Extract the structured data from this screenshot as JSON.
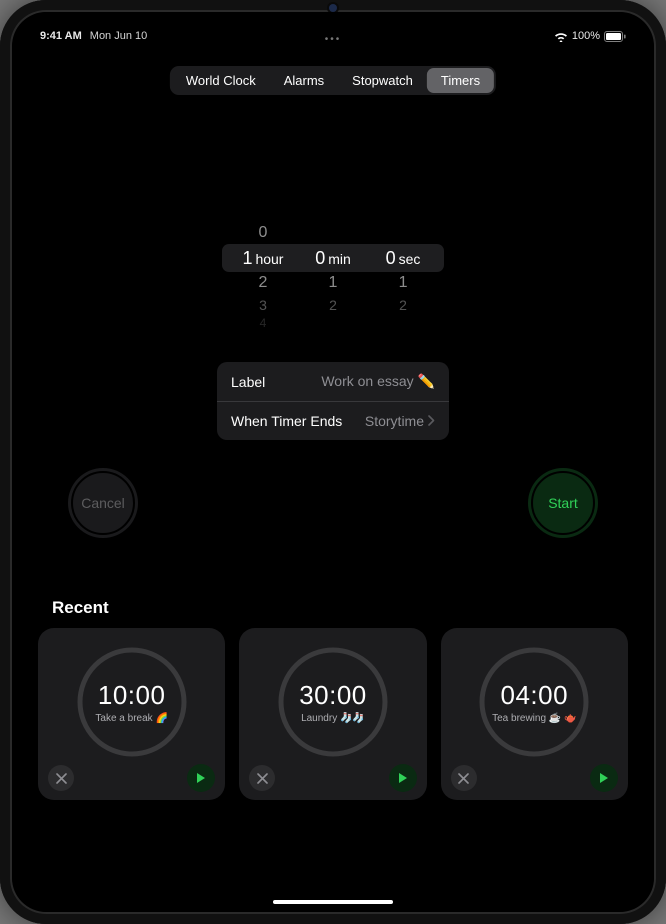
{
  "status": {
    "time": "9:41 AM",
    "date": "Mon Jun 10",
    "battery_pct": "100%"
  },
  "tabs": {
    "items": [
      "World Clock",
      "Alarms",
      "Stopwatch",
      "Timers"
    ],
    "active_index": 3
  },
  "picker": {
    "hours": {
      "above": [
        "0"
      ],
      "current": "1",
      "unit": "hour",
      "below": [
        "2",
        "3",
        "4"
      ]
    },
    "minutes": {
      "above": [
        ""
      ],
      "current": "0",
      "unit": "min",
      "below": [
        "1",
        "2"
      ]
    },
    "seconds": {
      "above": [
        ""
      ],
      "current": "0",
      "unit": "sec",
      "below": [
        "1",
        "2"
      ]
    }
  },
  "settings": {
    "label_key": "Label",
    "label_value": "Work on essay ✏️",
    "ends_key": "When Timer Ends",
    "ends_value": "Storytime"
  },
  "buttons": {
    "cancel": "Cancel",
    "start": "Start"
  },
  "recent": {
    "heading": "Recent",
    "items": [
      {
        "time": "10:00",
        "label": "Take a break 🌈"
      },
      {
        "time": "30:00",
        "label": "Laundry 🧦🧦"
      },
      {
        "time": "04:00",
        "label": "Tea brewing ☕️ 🫖"
      }
    ]
  }
}
